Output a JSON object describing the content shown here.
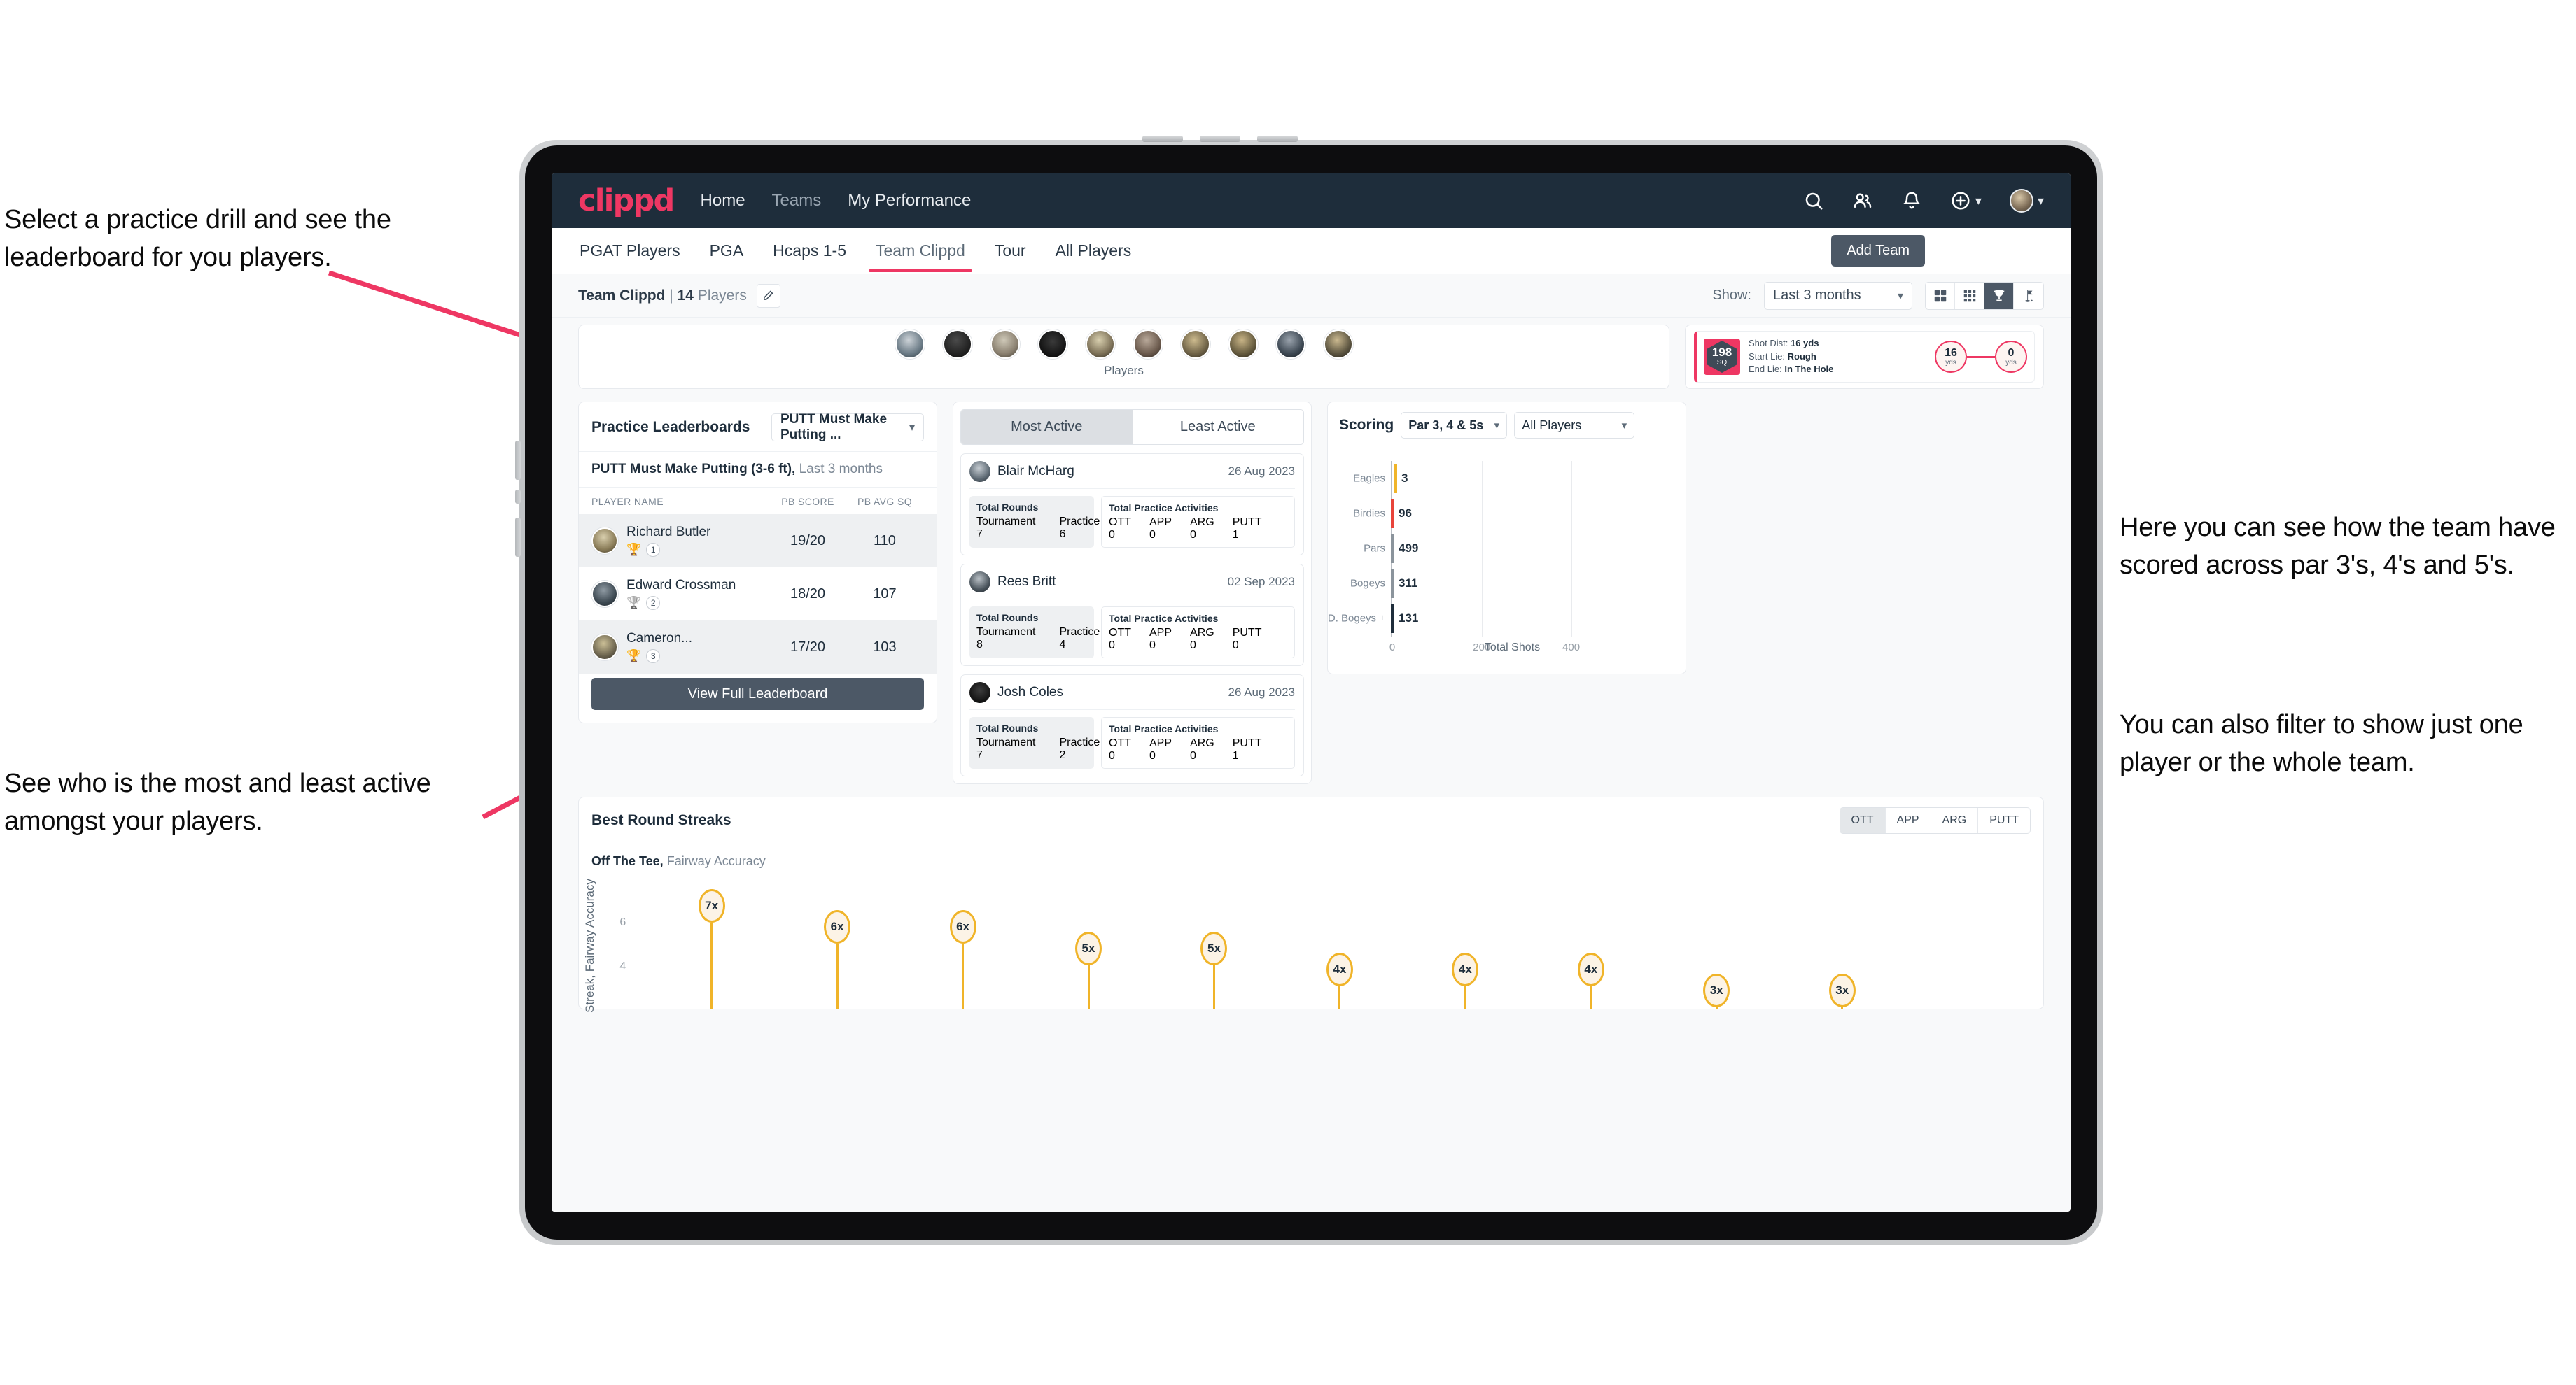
{
  "annotations": {
    "drill": "Select a practice drill and see the leaderboard for you players.",
    "activity": "See who is the most and least active amongst your players.",
    "scoring": "Here you can see how the team have scored across par 3's, 4's and 5's.",
    "filter": "You can also filter to show just one player or the whole team."
  },
  "navbar": {
    "brand": "clippd",
    "links": [
      {
        "label": "Home"
      },
      {
        "label": "Teams"
      },
      {
        "label": "My Performance"
      }
    ],
    "icons": [
      "search-icon",
      "people-icon",
      "bell-icon",
      "plus-circle-icon",
      "avatar"
    ]
  },
  "tabs": [
    {
      "label": "PGAT Players",
      "active": false
    },
    {
      "label": "PGA",
      "active": false
    },
    {
      "label": "Hcaps 1-5",
      "active": false
    },
    {
      "label": "Team Clippd",
      "active": true
    },
    {
      "label": "Tour",
      "active": false
    },
    {
      "label": "All Players",
      "active": false
    }
  ],
  "add_team_button": "Add Team",
  "toolbar": {
    "team_name": "Team Clippd",
    "separator": "|",
    "player_count": "14",
    "players_word": "Players",
    "show_label": "Show:",
    "range_value": "Last 3 months",
    "view_icons": [
      "grid-large-icon",
      "grid-small-icon",
      "trophy-icon",
      "flag-icon"
    ],
    "active_view": "trophy-icon"
  },
  "players_strip": {
    "caption": "Players",
    "count": 10
  },
  "shot_card": {
    "badge_value": "198",
    "badge_unit": "SQ",
    "shot_dist_label": "Shot Dist:",
    "shot_dist_value": "16 yds",
    "start_lie_label": "Start Lie:",
    "start_lie_value": "Rough",
    "end_lie_label": "End Lie:",
    "end_lie_value": "In The Hole",
    "from_value": "16",
    "from_unit": "yds",
    "to_value": "0",
    "to_unit": "yds"
  },
  "leaderboard": {
    "title": "Practice Leaderboards",
    "drill_select": "PUTT Must Make Putting ...",
    "subtitle_bold": "PUTT Must Make Putting (3-6 ft),",
    "subtitle_muted": "Last 3 months",
    "columns": [
      "PLAYER NAME",
      "PB SCORE",
      "PB AVG SQ"
    ],
    "rows": [
      {
        "name": "Richard Butler",
        "rank": "1",
        "trophy": "gold",
        "pb_score": "19/20",
        "pb_avg_sq": "110",
        "highlight": true
      },
      {
        "name": "Edward Crossman",
        "rank": "2",
        "trophy": "silver",
        "pb_score": "18/20",
        "pb_avg_sq": "107",
        "highlight": false
      },
      {
        "name": "Cameron...",
        "rank": "3",
        "trophy": "bronze",
        "pb_score": "17/20",
        "pb_avg_sq": "103",
        "highlight": true
      }
    ],
    "button": "View Full Leaderboard"
  },
  "activity": {
    "tabs": [
      {
        "label": "Most Active",
        "active": true
      },
      {
        "label": "Least Active",
        "active": false
      }
    ],
    "rounds_title": "Total Rounds",
    "rounds_keys": [
      "Tournament",
      "Practice"
    ],
    "acts_title": "Total Practice Activities",
    "acts_keys": [
      "OTT",
      "APP",
      "ARG",
      "PUTT"
    ],
    "items": [
      {
        "name": "Blair McHarg",
        "date": "26 Aug 2023",
        "tournament": "7",
        "practice": "6",
        "ott": "0",
        "app": "0",
        "arg": "0",
        "putt": "1"
      },
      {
        "name": "Rees Britt",
        "date": "02 Sep 2023",
        "tournament": "8",
        "practice": "4",
        "ott": "0",
        "app": "0",
        "arg": "0",
        "putt": "0"
      },
      {
        "name": "Josh Coles",
        "date": "26 Aug 2023",
        "tournament": "7",
        "practice": "2",
        "ott": "0",
        "app": "0",
        "arg": "0",
        "putt": "1"
      }
    ]
  },
  "scoring": {
    "title": "Scoring",
    "par_select": "Par 3, 4 & 5s",
    "player_select": "All Players"
  },
  "streaks": {
    "title": "Best Round Streaks",
    "segments": [
      {
        "label": "OTT",
        "active": true
      },
      {
        "label": "APP",
        "active": false
      },
      {
        "label": "ARG",
        "active": false
      },
      {
        "label": "PUTT",
        "active": false
      }
    ],
    "subtitle_bold": "Off The Tee,",
    "subtitle_muted": "Fairway Accuracy"
  },
  "colors": {
    "brand_pink": "#ee3763",
    "navy": "#1e2d3b",
    "slate": "#4c5866",
    "amber": "#f0b429",
    "annotation_arrow": "#ee3763"
  },
  "chart_data": [
    {
      "type": "bar",
      "orientation": "horizontal",
      "title": "Scoring",
      "categories": [
        "Eagles",
        "Birdies",
        "Pars",
        "Bogeys",
        "D. Bogeys +"
      ],
      "values": [
        3,
        96,
        499,
        311,
        131
      ],
      "cap_colors": [
        "#f0b429",
        "#e8443a",
        "#8b949c",
        "#8b949c",
        "#1e2d3b"
      ],
      "xlabel": "Total Shots",
      "ylabel": "",
      "xticks": [
        0,
        200,
        400
      ],
      "xlim": [
        0,
        540
      ],
      "grid": true,
      "legend": "none"
    },
    {
      "type": "scatter",
      "variant": "lollipop",
      "title": "Best Round Streaks",
      "subtitle": "Off The Tee, Fairway Accuracy",
      "ylabel": "Streak, Fairway Accuracy",
      "yticks": [
        4,
        6
      ],
      "ylim": [
        0,
        8
      ],
      "grid": true,
      "labels": [
        "7x",
        "6x",
        "6x",
        "5x",
        "5x",
        "4x",
        "4x",
        "4x",
        "3x",
        "3x"
      ],
      "values": [
        7,
        6,
        6,
        5,
        5,
        4,
        4,
        4,
        3,
        3
      ],
      "x_positions": [
        6,
        15,
        24,
        33,
        42,
        51,
        60,
        69,
        78,
        87
      ]
    }
  ]
}
